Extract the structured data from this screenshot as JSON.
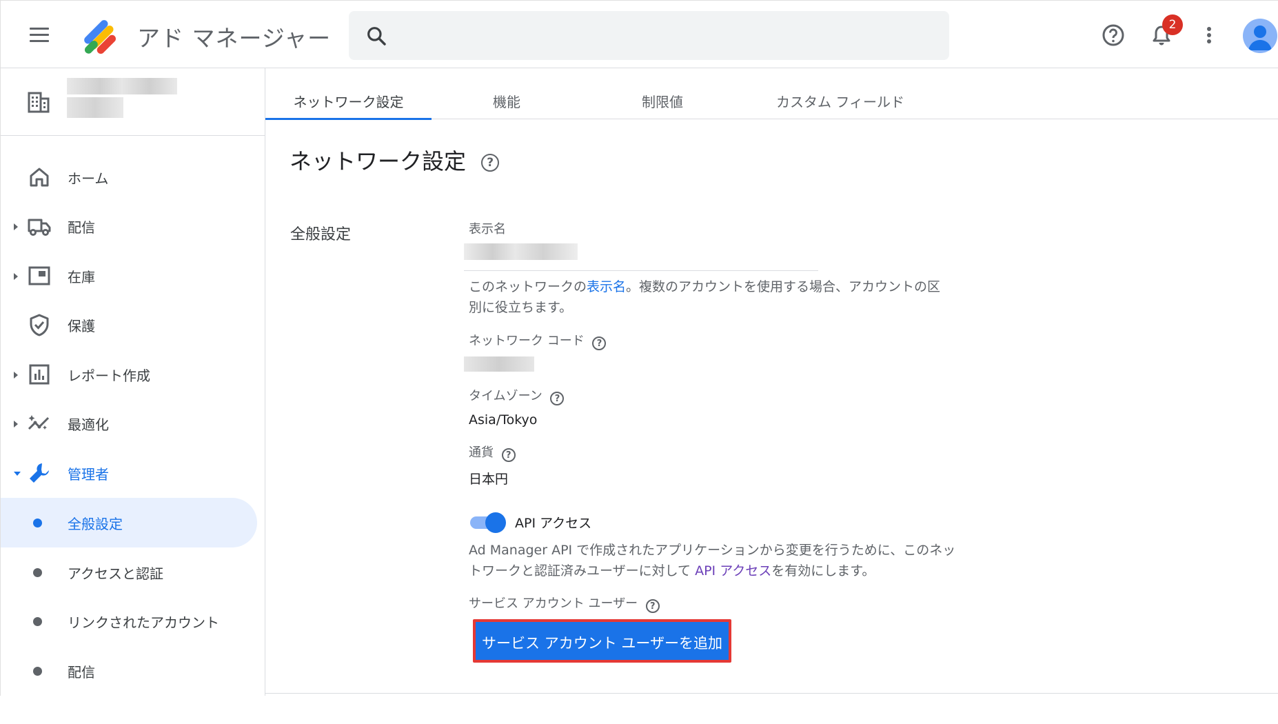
{
  "app": {
    "title": "アド マネージャー"
  },
  "search": {
    "placeholder": ""
  },
  "notifications": {
    "count": "2"
  },
  "sidebar": {
    "items": [
      {
        "label": "ホーム"
      },
      {
        "label": "配信"
      },
      {
        "label": "在庫"
      },
      {
        "label": "保護"
      },
      {
        "label": "レポート作成"
      },
      {
        "label": "最適化"
      },
      {
        "label": "管理者"
      }
    ],
    "admin_sub": [
      {
        "label": "全般設定"
      },
      {
        "label": "アクセスと認証"
      },
      {
        "label": "リンクされたアカウント"
      },
      {
        "label": "配信"
      }
    ]
  },
  "tabs": [
    {
      "label": "ネットワーク設定"
    },
    {
      "label": "機能"
    },
    {
      "label": "制限値"
    },
    {
      "label": "カスタム フィールド"
    }
  ],
  "page": {
    "title": "ネットワーク設定",
    "section": "全般設定",
    "display_name_label": "表示名",
    "display_name_desc_before": "このネットワークの",
    "display_name_desc_link": "表示名",
    "display_name_desc_after": "。複数のアカウントを使用する場合、アカウントの区",
    "display_name_desc_line2": "別に役立ちます。",
    "network_code_label": "ネットワーク コード",
    "timezone_label": "タイムゾーン",
    "timezone_value": "Asia/Tokyo",
    "currency_label": "通貨",
    "currency_value": "日本円",
    "api_toggle_label": "API アクセス",
    "api_desc_line1": "Ad Manager API で作成されたアプリケーションから変更を行うために、このネッ",
    "api_desc_line2_before": "トワークと認証済みユーザーに対して ",
    "api_desc_line2_link": "API アクセス",
    "api_desc_line2_after": "を有効にします。",
    "service_account_label": "サービス アカウント ユーザー",
    "add_service_account_button": "サービス アカウント ユーザーを追加"
  },
  "colors": {
    "accent": "#1a73e8",
    "highlight_border": "#e53935",
    "badge": "#d93025"
  }
}
